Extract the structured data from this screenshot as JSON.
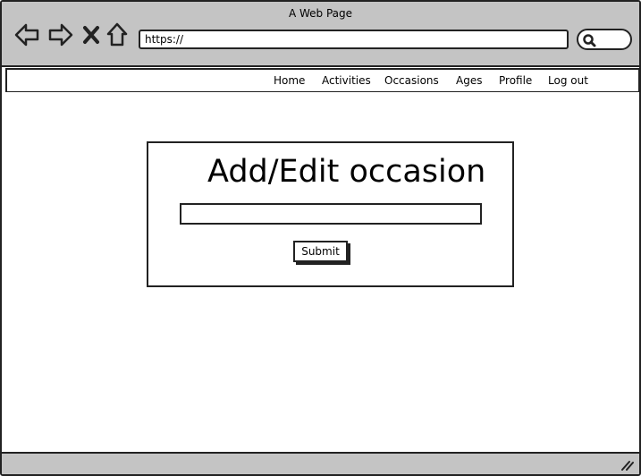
{
  "window": {
    "title": "A Web Page"
  },
  "browser": {
    "url": "https://",
    "back_icon": "back-arrow-icon",
    "forward_icon": "forward-arrow-icon",
    "stop_icon": "close-icon",
    "home_icon": "home-icon",
    "search_icon": "search-icon"
  },
  "nav": {
    "items": [
      {
        "label": "Home"
      },
      {
        "label": "Activities"
      },
      {
        "label": "Occasions"
      },
      {
        "label": "Ages"
      },
      {
        "label": "Profile"
      },
      {
        "label": "Log out"
      }
    ]
  },
  "form": {
    "title": "Add/Edit occasion",
    "input_value": "",
    "submit_label": "Submit"
  }
}
